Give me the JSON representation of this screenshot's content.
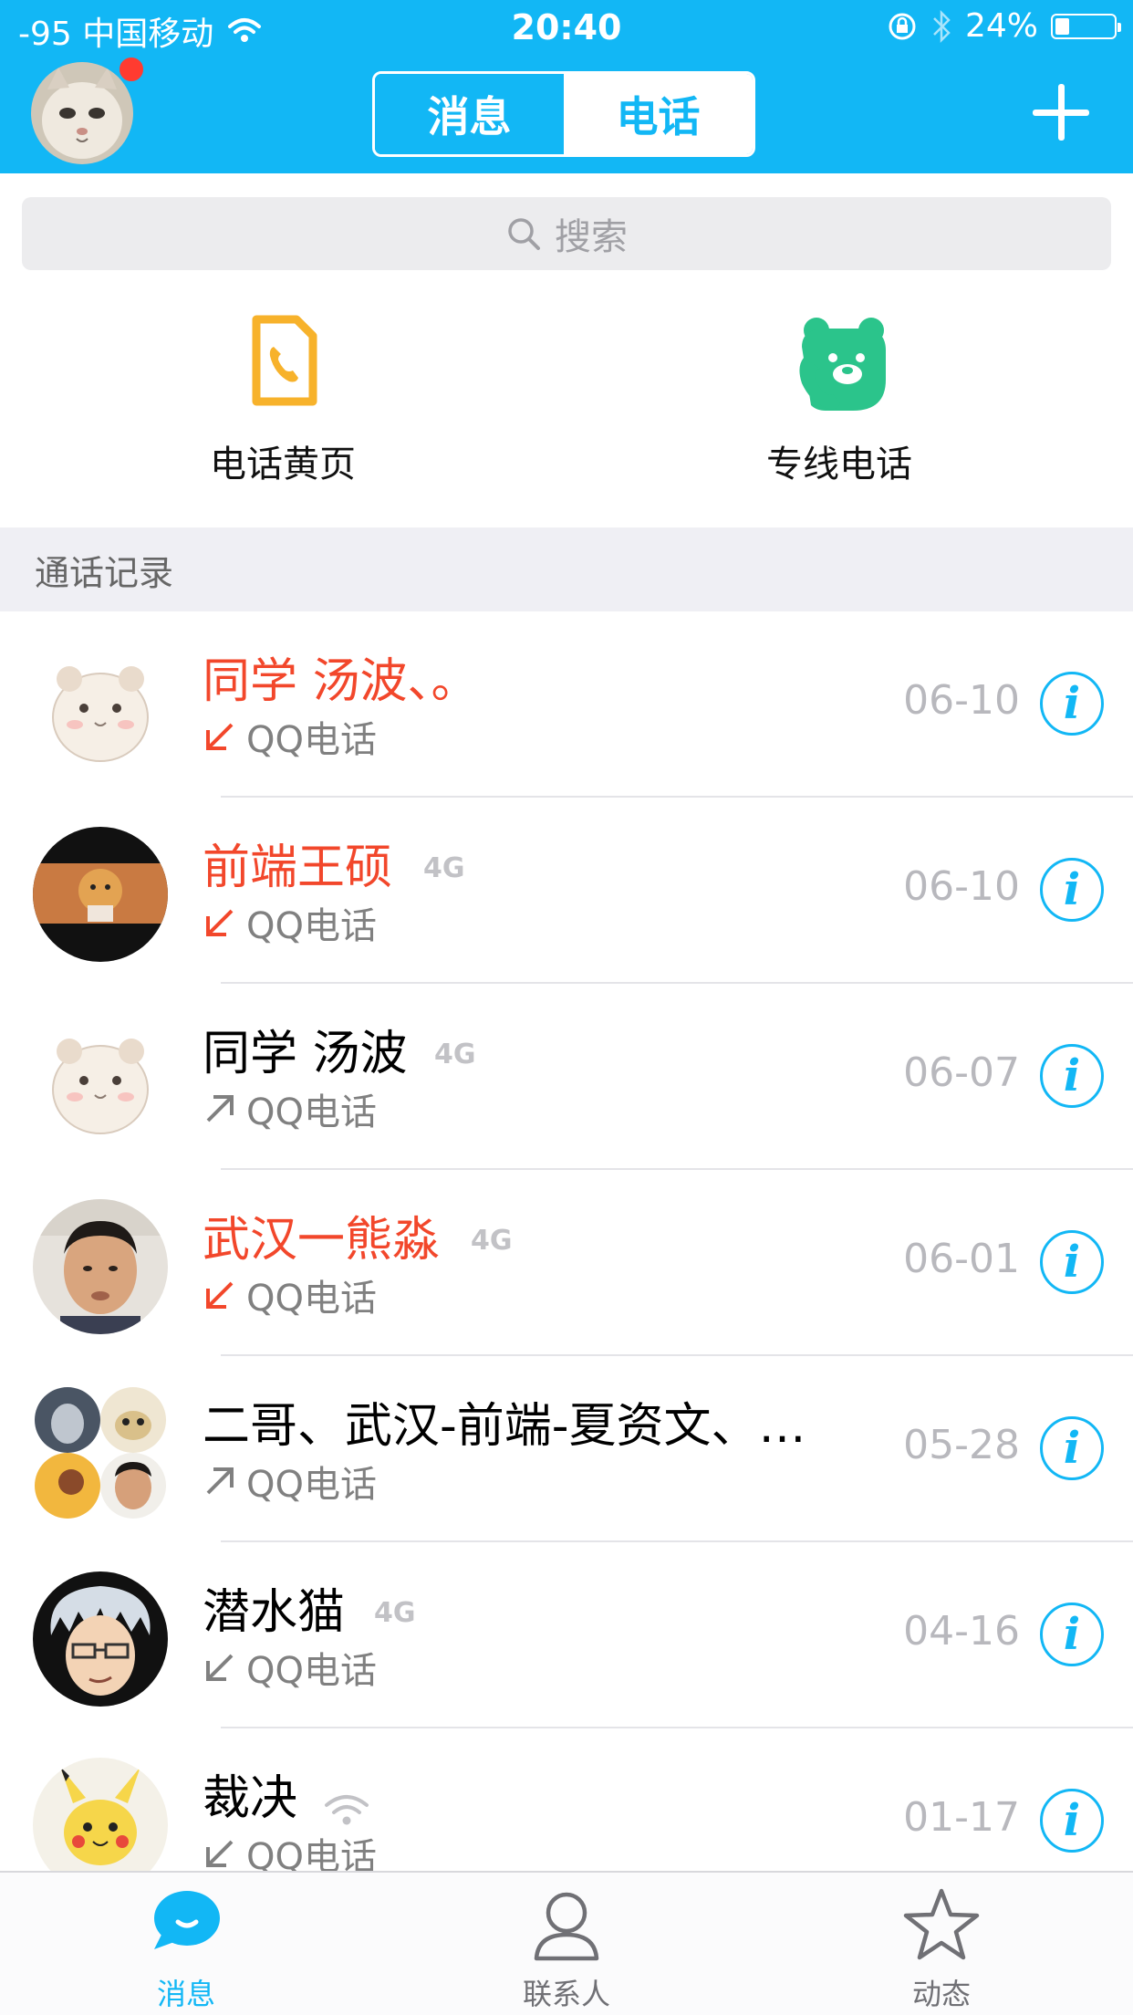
{
  "status_bar": {
    "carrier": "-95 中国移动",
    "time": "20:40",
    "battery": "24%",
    "battery_level": 0.24
  },
  "header": {
    "tabs": [
      "消息",
      "电话"
    ],
    "active_tab": "电话"
  },
  "search": {
    "placeholder": "搜索"
  },
  "quick_entries": [
    {
      "label": "电话黄页",
      "icon": "phone-book-icon"
    },
    {
      "label": "专线电话",
      "icon": "bear-phone-icon"
    }
  ],
  "section_title": "通话记录",
  "calls": [
    {
      "name": "同学 汤波、。",
      "missed": true,
      "direction": "incoming",
      "badge": "",
      "type": "QQ电话",
      "date": "06-10"
    },
    {
      "name": "前端王硕",
      "missed": true,
      "direction": "incoming",
      "badge": "4G",
      "type": "QQ电话",
      "date": "06-10"
    },
    {
      "name": "同学 汤波",
      "missed": false,
      "direction": "outgoing",
      "badge": "4G",
      "type": "QQ电话",
      "date": "06-07"
    },
    {
      "name": "武汉一熊淼",
      "missed": true,
      "direction": "incoming",
      "badge": "4G",
      "type": "QQ电话",
      "date": "06-01"
    },
    {
      "name": "二哥、武汉-前端-夏资文、…",
      "missed": false,
      "direction": "outgoing",
      "badge": "",
      "type": "QQ电话",
      "date": "05-28"
    },
    {
      "name": "潜水猫",
      "missed": false,
      "direction": "incoming",
      "badge": "4G",
      "type": "QQ电话",
      "date": "04-16"
    },
    {
      "name": "裁决",
      "missed": false,
      "direction": "incoming",
      "badge": "wifi",
      "type": "QQ电话",
      "date": "01-17"
    }
  ],
  "tab_bar": [
    {
      "label": "消息",
      "icon": "chat-bubble-icon",
      "active": true
    },
    {
      "label": "联系人",
      "icon": "person-icon",
      "active": false
    },
    {
      "label": "动态",
      "icon": "star-icon",
      "active": false
    }
  ],
  "colors": {
    "brand_blue": "#12b7f5",
    "missed_red": "#f2472b",
    "notification_dot": "#ff3b30"
  }
}
